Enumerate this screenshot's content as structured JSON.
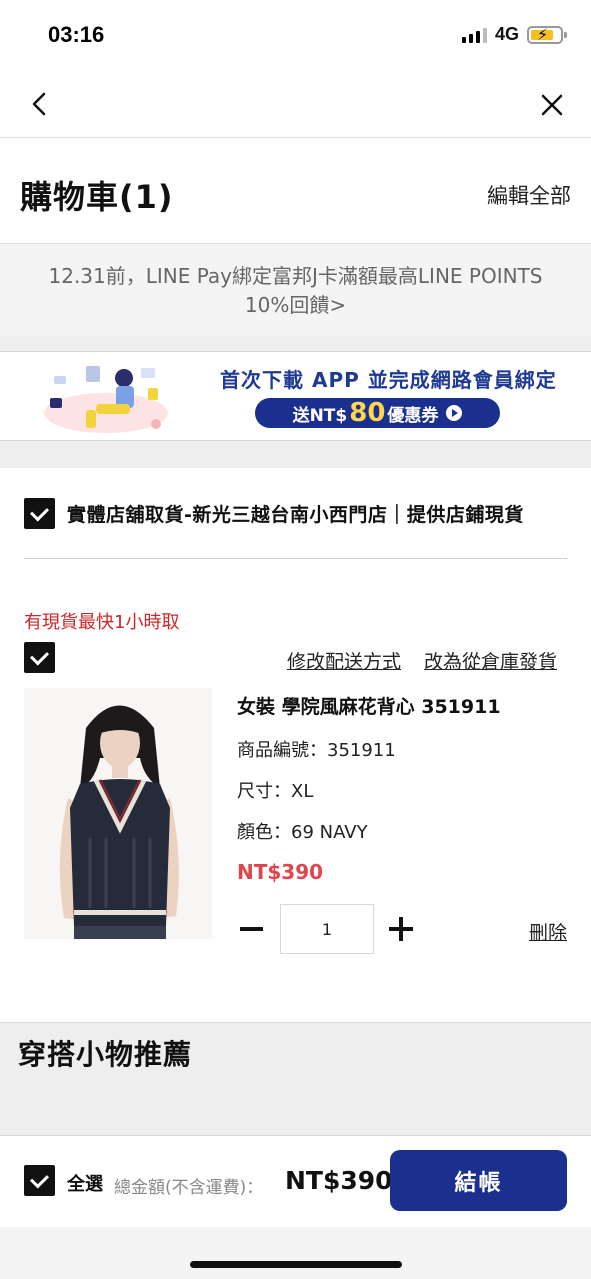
{
  "status_bar": {
    "time": "03:16",
    "network": "4G"
  },
  "header": {
    "title": "購物車(1)",
    "edit_all": "編輯全部"
  },
  "promo": {
    "line1": "12.31前，LINE Pay綁定富邦J卡滿額最高LINE POINTS",
    "line2": "10%回饋>"
  },
  "banner": {
    "headline": "首次下載 APP 並完成網路會員綁定",
    "pill_prefix": "送NT$",
    "pill_amount": "80",
    "pill_suffix": "優惠券"
  },
  "store": {
    "title": "實體店舖取貨-新光三越台南小西門店｜提供店鋪現貨"
  },
  "item": {
    "stock_note": "有現貨最快1小時取",
    "change_delivery": "修改配送方式",
    "ship_from_warehouse": "改為從倉庫發貨",
    "name": "女裝 學院風麻花背心 351911",
    "product_code": "商品編號：351911",
    "size": "尺寸：XL",
    "color": "顏色：69 NAVY",
    "price": "NT$390",
    "quantity": "1",
    "delete": "刪除"
  },
  "recommend": {
    "title": "穿搭小物推薦"
  },
  "footer": {
    "select_all": "全選",
    "total_label": "總金額(不含運費)：",
    "total_value": "NT$390",
    "checkout": "結帳"
  },
  "colors": {
    "brand_blue": "#1b2f8f",
    "price_red": "#e0454b",
    "note_red": "#d0262a"
  }
}
